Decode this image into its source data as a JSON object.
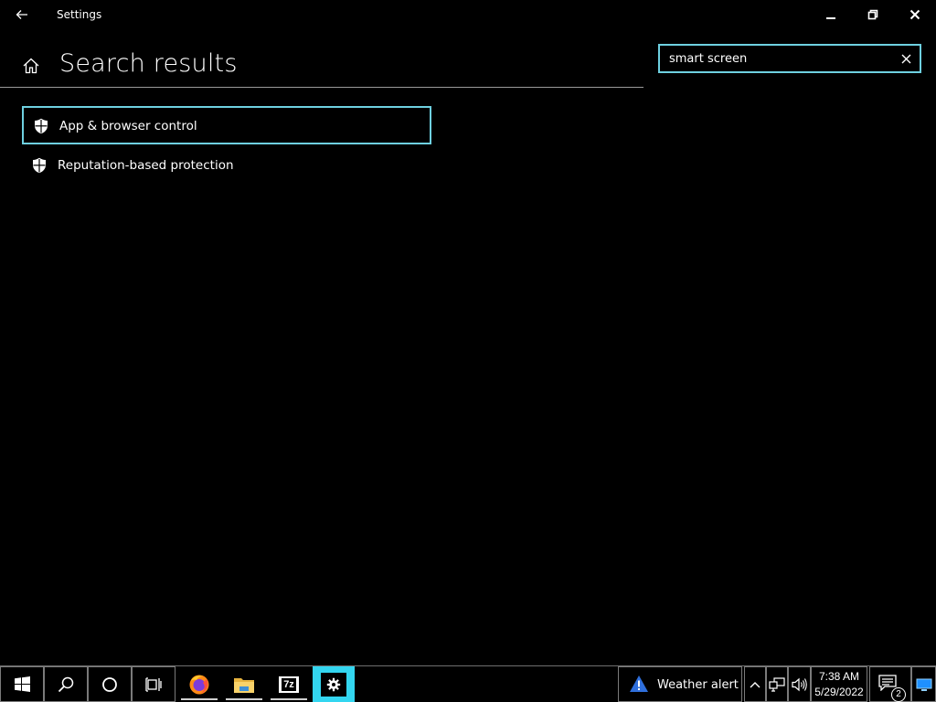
{
  "window": {
    "title": "Settings",
    "back_icon": "back-arrow-icon",
    "controls": {
      "minimize_icon": "minimize-icon",
      "restore_icon": "restore-icon",
      "close_icon": "close-icon"
    }
  },
  "page": {
    "title": "Search results",
    "home_icon": "home-icon"
  },
  "search": {
    "value": "smart screen",
    "clear_icon": "clear-icon"
  },
  "results": [
    {
      "label": "App & browser control",
      "icon": "shield-icon",
      "selected": true
    },
    {
      "label": "Reputation-based protection",
      "icon": "shield-icon",
      "selected": false
    }
  ],
  "taskbar": {
    "start_icon": "windows-logo-icon",
    "search_icon": "search-icon",
    "cortana_icon": "cortana-circle-icon",
    "task_view_icon": "task-view-icon",
    "apps": [
      {
        "name": "Firefox",
        "icon": "firefox-icon",
        "active": false
      },
      {
        "name": "File Explorer",
        "icon": "folder-icon",
        "active": false
      },
      {
        "name": "7-Zip",
        "icon": "seven-zip-icon",
        "label": "7z",
        "active": false
      },
      {
        "name": "Settings",
        "icon": "gear-icon",
        "active": true
      }
    ],
    "weather": {
      "label": "Weather alert",
      "icon": "warning-icon"
    },
    "tray": {
      "chevron_icon": "chevron-up-icon",
      "network_icon": "network-icon",
      "volume_icon": "volume-icon"
    },
    "clock": {
      "time": "7:38 AM",
      "date": "5/29/2022"
    },
    "notifications": {
      "count": "2",
      "icon": "action-center-icon"
    },
    "show_desktop_icon": "show-desktop-icon"
  },
  "colors": {
    "accent": "#6ed0e0",
    "active_app": "#33d6f0",
    "background": "#000000"
  }
}
